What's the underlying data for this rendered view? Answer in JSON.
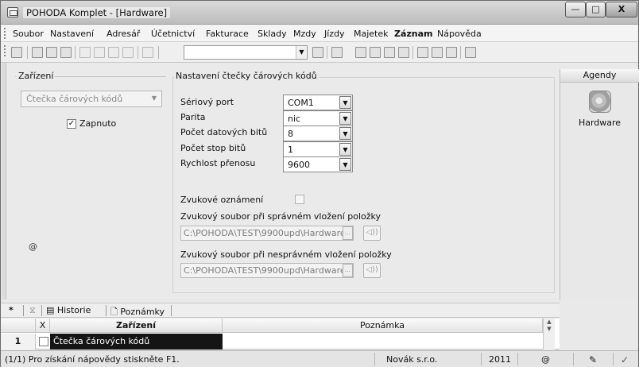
{
  "window": {
    "title": "POHODA Komplet - [Hardware]",
    "controls": {
      "minimize": "—",
      "maximize": "□",
      "close": "X"
    }
  },
  "menu": [
    {
      "label": "Soubor"
    },
    {
      "label": "Nastavení"
    },
    {
      "label": "Adresář"
    },
    {
      "label": "Účetnictví"
    },
    {
      "label": "Fakturace"
    },
    {
      "label": "Sklady"
    },
    {
      "label": "Mzdy"
    },
    {
      "label": "Jízdy"
    },
    {
      "label": "Majetek"
    },
    {
      "label": "Záznam"
    },
    {
      "label": "Nápověda"
    }
  ],
  "device_panel": {
    "group_title": "Zařízení",
    "combo_value": "Čtečka čárových kódů",
    "enabled_label": "Zapnuto",
    "enabled_checked": true,
    "at_sign": "@"
  },
  "reader_settings": {
    "group_title": "Nastavení čtečky čárových kódů",
    "fields": [
      {
        "label": "Sériový port",
        "value": "COM1"
      },
      {
        "label": "Parita",
        "value": "nic"
      },
      {
        "label": "Počet datových bitů",
        "value": "8"
      },
      {
        "label": "Počet stop bitů",
        "value": "1"
      },
      {
        "label": "Rychlost přenosu",
        "value": "9600"
      }
    ],
    "sound_notify_label": "Zvukové oznámení",
    "sound_notify_checked": false,
    "sound_ok_label": "Zvukový soubor při správném vložení položky",
    "sound_ok_path": "C:\\POHODA\\TEST\\9900upd\\Hardware\\St",
    "sound_bad_label": "Zvukový soubor při nesprávném vložení položky",
    "sound_bad_path": "C:\\POHODA\\TEST\\9900upd\\Hardware\\St",
    "browse": "...",
    "play": "◁))"
  },
  "agendy": {
    "title": "Agendy",
    "item_label": "Hardware"
  },
  "bottom_tabs": {
    "star": "*",
    "historie": "Historie",
    "poznamky": "Poznámky"
  },
  "table": {
    "headers": [
      "X",
      "Zařízení",
      "Poznámka"
    ],
    "rows": [
      {
        "num": "1",
        "checked": false,
        "device": "Čtečka čárových kódů",
        "note": ""
      }
    ]
  },
  "status": {
    "help": "(1/1) Pro získání nápovědy stiskněte F1.",
    "company": "Novák s.r.o.",
    "year": "2011",
    "at": "@"
  }
}
